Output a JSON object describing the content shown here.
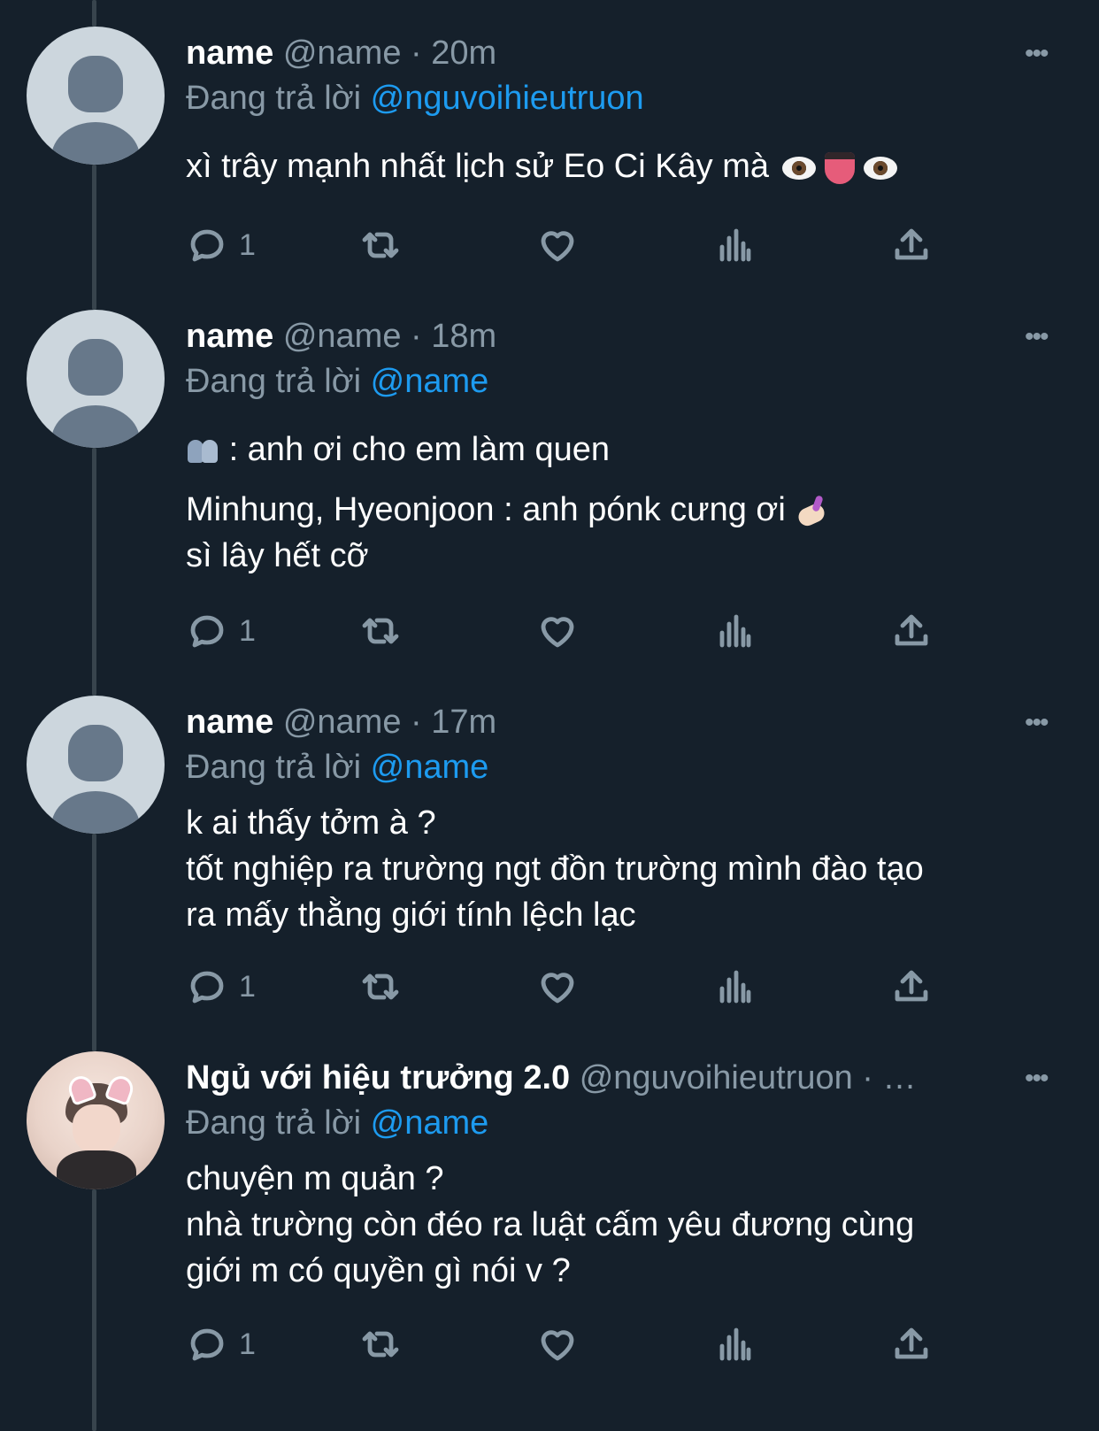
{
  "tweets": [
    {
      "name": "name",
      "handle": "@name",
      "time": "· 20m",
      "reply_label": "Đang trả lời",
      "reply_mention": "@nguvoihieutruon",
      "lines": [
        "xì trây mạnh nhất lịch sử Eo Ci Kây mà"
      ],
      "emoji_line": [
        "eyes-emoji",
        "tongue-emoji",
        "eyes-emoji"
      ],
      "reply_count": "1"
    },
    {
      "name": "name",
      "handle": "@name",
      "time": "· 18m",
      "reply_label": "Đang trả lời",
      "reply_mention": "@name",
      "lines": [
        ": anh ơi cho em làm quen",
        "Minhung, Hyeonjoon : anh pónk cưng ơi",
        "sì lây hết cỡ"
      ],
      "reply_count": "1"
    },
    {
      "name": "name",
      "handle": "@name",
      "time": "· 17m",
      "reply_label": "Đang trả lời",
      "reply_mention": "@name",
      "lines": [
        "k ai thấy tởm à ?",
        "tốt nghiệp ra trường ngt đồn trường mình đào tạo",
        "ra mấy thằng giới tính lệch lạc"
      ],
      "reply_count": "1"
    },
    {
      "name": "Ngủ với hiệu trưởng 2.0",
      "handle": "@nguvoihieutruon · …",
      "reply_label": "Đang trả lời",
      "reply_mention": "@name",
      "lines": [
        "chuyện m quản ?",
        "nhà trường còn đéo ra luật cấm yêu đương cùng",
        "giới m có quyền gì nói v ?"
      ],
      "reply_count": "1"
    }
  ],
  "icons": {
    "reply": "reply-icon",
    "retweet": "retweet-icon",
    "like": "heart-icon",
    "views": "analytics-icon",
    "share": "share-icon",
    "more": "more-icon"
  },
  "colors": {
    "background": "#15202b",
    "muted": "#8899a6",
    "link": "#1d9bf0",
    "thread_line": "#38444d"
  }
}
